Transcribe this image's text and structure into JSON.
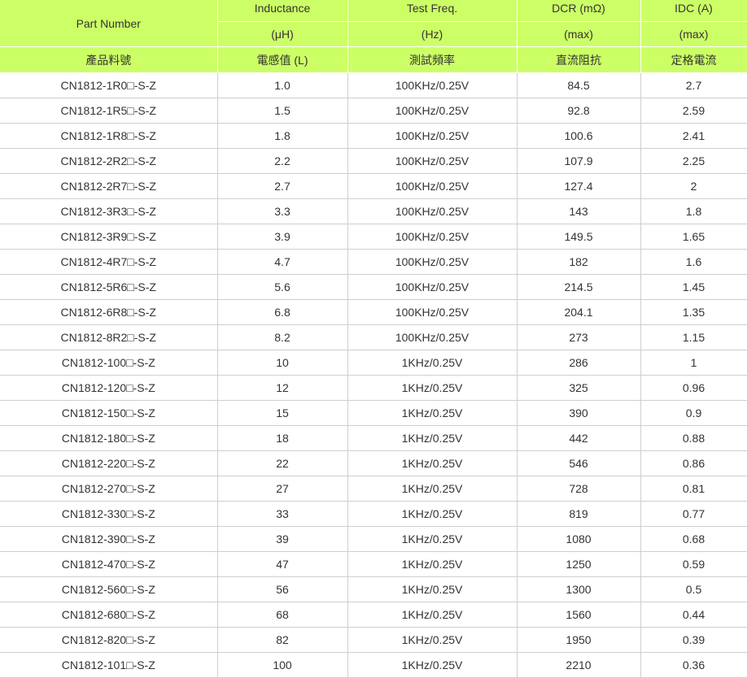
{
  "header": {
    "part_number": "Part Number",
    "inductance": "Inductance",
    "inductance_unit": "(μH)",
    "test_freq": "Test Freq.",
    "test_freq_unit": "(Hz)",
    "dcr": "DCR (mΩ)",
    "dcr_unit": "(max)",
    "idc": "IDC (A)",
    "idc_unit": "(max)",
    "zh_part": "產品料號",
    "zh_inductance": "電感值 (L)",
    "zh_test_freq": "測試頻率",
    "zh_dcr": "直流阻抗",
    "zh_idc": "定格電流"
  },
  "rows": [
    {
      "part": "CN1812-1R0□-S-Z",
      "l": "1.0",
      "freq": "100KHz/0.25V",
      "dcr": "84.5",
      "idc": "2.7"
    },
    {
      "part": "CN1812-1R5□-S-Z",
      "l": "1.5",
      "freq": "100KHz/0.25V",
      "dcr": "92.8",
      "idc": "2.59"
    },
    {
      "part": "CN1812-1R8□-S-Z",
      "l": "1.8",
      "freq": "100KHz/0.25V",
      "dcr": "100.6",
      "idc": "2.41"
    },
    {
      "part": "CN1812-2R2□-S-Z",
      "l": "2.2",
      "freq": "100KHz/0.25V",
      "dcr": "107.9",
      "idc": "2.25"
    },
    {
      "part": "CN1812-2R7□-S-Z",
      "l": "2.7",
      "freq": "100KHz/0.25V",
      "dcr": "127.4",
      "idc": "2"
    },
    {
      "part": "CN1812-3R3□-S-Z",
      "l": "3.3",
      "freq": "100KHz/0.25V",
      "dcr": "143",
      "idc": "1.8"
    },
    {
      "part": "CN1812-3R9□-S-Z",
      "l": "3.9",
      "freq": "100KHz/0.25V",
      "dcr": "149.5",
      "idc": "1.65"
    },
    {
      "part": "CN1812-4R7□-S-Z",
      "l": "4.7",
      "freq": "100KHz/0.25V",
      "dcr": "182",
      "idc": "1.6"
    },
    {
      "part": "CN1812-5R6□-S-Z",
      "l": "5.6",
      "freq": "100KHz/0.25V",
      "dcr": "214.5",
      "idc": "1.45"
    },
    {
      "part": "CN1812-6R8□-S-Z",
      "l": "6.8",
      "freq": "100KHz/0.25V",
      "dcr": "204.1",
      "idc": "1.35"
    },
    {
      "part": "CN1812-8R2□-S-Z",
      "l": "8.2",
      "freq": "100KHz/0.25V",
      "dcr": "273",
      "idc": "1.15"
    },
    {
      "part": "CN1812-100□-S-Z",
      "l": "10",
      "freq": "1KHz/0.25V",
      "dcr": "286",
      "idc": "1"
    },
    {
      "part": "CN1812-120□-S-Z",
      "l": "12",
      "freq": "1KHz/0.25V",
      "dcr": "325",
      "idc": "0.96"
    },
    {
      "part": "CN1812-150□-S-Z",
      "l": "15",
      "freq": "1KHz/0.25V",
      "dcr": "390",
      "idc": "0.9"
    },
    {
      "part": "CN1812-180□-S-Z",
      "l": "18",
      "freq": "1KHz/0.25V",
      "dcr": "442",
      "idc": "0.88"
    },
    {
      "part": "CN1812-220□-S-Z",
      "l": "22",
      "freq": "1KHz/0.25V",
      "dcr": "546",
      "idc": "0.86"
    },
    {
      "part": "CN1812-270□-S-Z",
      "l": "27",
      "freq": "1KHz/0.25V",
      "dcr": "728",
      "idc": "0.81"
    },
    {
      "part": "CN1812-330□-S-Z",
      "l": "33",
      "freq": "1KHz/0.25V",
      "dcr": "819",
      "idc": "0.77"
    },
    {
      "part": "CN1812-390□-S-Z",
      "l": "39",
      "freq": "1KHz/0.25V",
      "dcr": "1080",
      "idc": "0.68"
    },
    {
      "part": "CN1812-470□-S-Z",
      "l": "47",
      "freq": "1KHz/0.25V",
      "dcr": "1250",
      "idc": "0.59"
    },
    {
      "part": "CN1812-560□-S-Z",
      "l": "56",
      "freq": "1KHz/0.25V",
      "dcr": "1300",
      "idc": "0.5"
    },
    {
      "part": "CN1812-680□-S-Z",
      "l": "68",
      "freq": "1KHz/0.25V",
      "dcr": "1560",
      "idc": "0.44"
    },
    {
      "part": "CN1812-820□-S-Z",
      "l": "82",
      "freq": "1KHz/0.25V",
      "dcr": "1950",
      "idc": "0.39"
    },
    {
      "part": "CN1812-101□-S-Z",
      "l": "100",
      "freq": "1KHz/0.25V",
      "dcr": "2210",
      "idc": "0.36"
    }
  ],
  "colors": {
    "header_bg": "#ccff66",
    "grid_line": "#cfcfcf",
    "text": "#333333"
  }
}
